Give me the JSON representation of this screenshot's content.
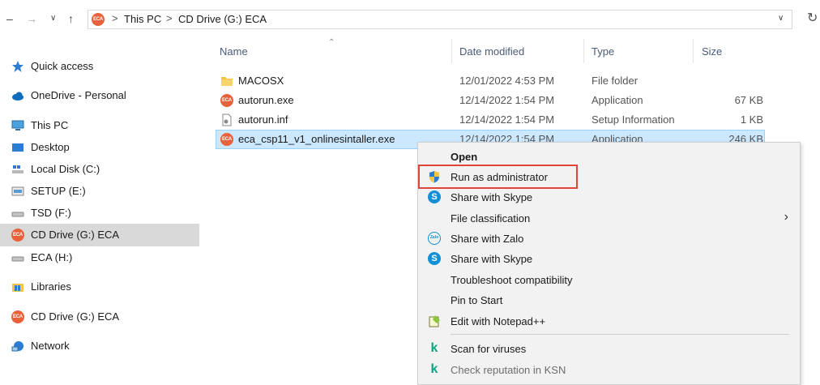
{
  "address_bar": {
    "back_icon": "back-arrow-icon",
    "forward_icon": "forward-arrow-icon",
    "recent_icon": "chevron-down-icon",
    "up_icon": "up-arrow-icon",
    "badge_text": "ECA",
    "crumbs": [
      "This PC",
      "CD Drive (G:) ECA"
    ],
    "separator": ">"
  },
  "sidebar": {
    "items": [
      {
        "label": "Quick access",
        "icon": "star-icon"
      },
      {
        "label": "OneDrive - Personal",
        "icon": "cloud-icon"
      },
      {
        "label": "This PC",
        "icon": "computer-icon"
      },
      {
        "label": "Desktop",
        "icon": "desktop-icon"
      },
      {
        "label": "Local Disk (C:)",
        "icon": "windows-drive-icon"
      },
      {
        "label": "SETUP (E:)",
        "icon": "drive-icon"
      },
      {
        "label": "TSD (F:)",
        "icon": "drive-icon"
      },
      {
        "label": "CD Drive (G:) ECA",
        "icon": "eca-drive-icon"
      },
      {
        "label": "ECA (H:)",
        "icon": "drive-icon"
      },
      {
        "label": "Libraries",
        "icon": "libraries-icon"
      },
      {
        "label": "CD Drive (G:) ECA",
        "icon": "eca-drive-icon"
      },
      {
        "label": "Network",
        "icon": "network-icon"
      }
    ]
  },
  "file_list": {
    "columns": [
      "Name",
      "Date modified",
      "Type",
      "Size"
    ],
    "rows": [
      {
        "name": "MACOSX",
        "date": "12/01/2022 4:53 PM",
        "type": "File folder",
        "size": "",
        "icon": "folder-icon"
      },
      {
        "name": "autorun.exe",
        "date": "12/14/2022 1:54 PM",
        "type": "Application",
        "size": "67 KB",
        "icon": "eca-app-icon"
      },
      {
        "name": "autorun.inf",
        "date": "12/14/2022 1:54 PM",
        "type": "Setup Information",
        "size": "1 KB",
        "icon": "setup-file-icon"
      },
      {
        "name": "eca_csp11_v1_onlinesintaller.exe",
        "date": "12/14/2022 1:54 PM",
        "type": "Application",
        "size": "246 KB",
        "icon": "eca-app-icon"
      }
    ]
  },
  "context_menu": {
    "items": [
      {
        "label": "Open",
        "icon": ""
      },
      {
        "label": "Run as administrator",
        "icon": "uac-shield-icon"
      },
      {
        "label": "Share with Skype",
        "icon": "skype-icon"
      },
      {
        "label": "File classification",
        "icon": ""
      },
      {
        "label": "Share with Zalo",
        "icon": "zalo-icon"
      },
      {
        "label": "Share with Skype",
        "icon": "skype-icon"
      },
      {
        "label": "Troubleshoot compatibility",
        "icon": ""
      },
      {
        "label": "Pin to Start",
        "icon": ""
      },
      {
        "label": "Edit with Notepad++",
        "icon": "notepad-plus-icon"
      },
      {
        "label": "Scan for viruses",
        "icon": "kaspersky-icon"
      },
      {
        "label": "Check reputation in KSN",
        "icon": "kaspersky-icon"
      }
    ],
    "icon_glyphs": {
      "skype": "S",
      "zalo": "Zalo",
      "kaspersky": "k"
    }
  },
  "colors": {
    "selection": "#cce8ff",
    "highlight_outline": "#e0453a",
    "eca_badge": "#e8613a"
  }
}
